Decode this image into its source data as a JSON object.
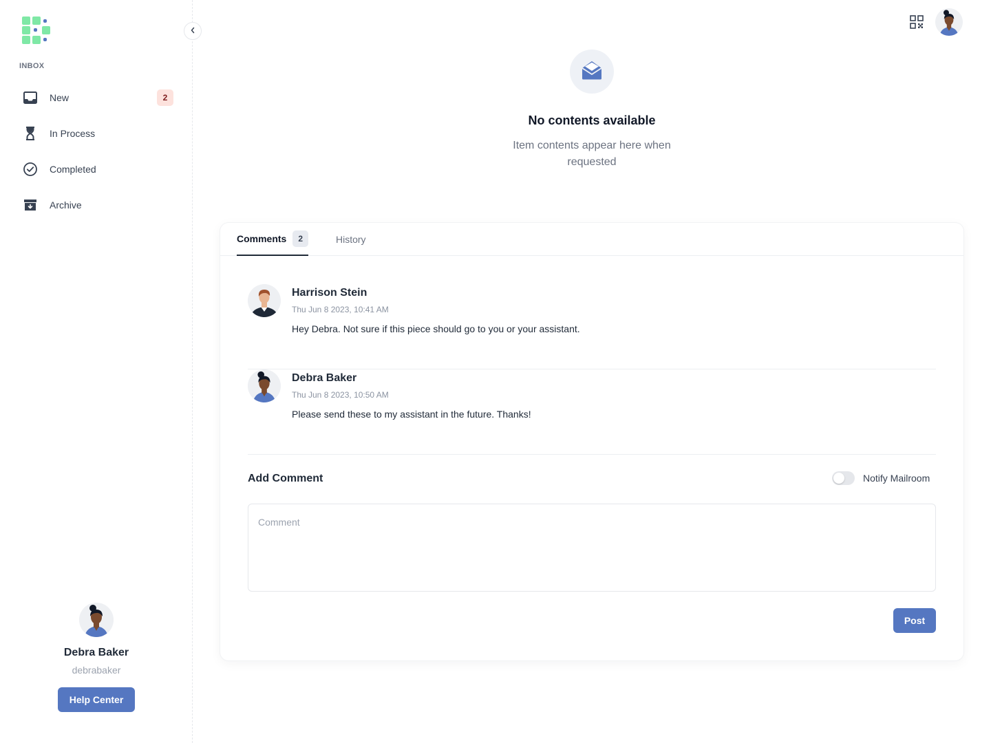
{
  "colors": {
    "accent": "#5577c1",
    "logo_green": "#7fe8a6",
    "logo_blue": "#5577c1",
    "badge_bg": "#fde2dd"
  },
  "sidebar": {
    "section_label": "INBOX",
    "items": [
      {
        "label": "New",
        "icon": "inbox-tray-icon",
        "badge": "2"
      },
      {
        "label": "In Process",
        "icon": "hourglass-icon"
      },
      {
        "label": "Completed",
        "icon": "check-circle-icon"
      },
      {
        "label": "Archive",
        "icon": "archive-box-icon"
      }
    ],
    "collapse_icon": "chevron-left-icon",
    "profile": {
      "name": "Debra Baker",
      "username": "debrabaker",
      "help_label": "Help Center"
    }
  },
  "header": {
    "qr_icon": "qr-code-icon"
  },
  "empty_state": {
    "icon": "envelope-open-icon",
    "title": "No contents available",
    "description": "Item contents appear here when requested"
  },
  "tabs": {
    "comments_label": "Comments",
    "comments_count": "2",
    "history_label": "History"
  },
  "comments": [
    {
      "author": "Harrison Stein",
      "time": "Thu Jun 8 2023, 10:41 AM",
      "text": "Hey Debra. Not sure if this piece should go to you or your assistant."
    },
    {
      "author": "Debra Baker",
      "time": "Thu Jun 8 2023, 10:50 AM",
      "text": "Please send these to my assistant in the future. Thanks!"
    }
  ],
  "add_comment": {
    "title": "Add Comment",
    "notify_label": "Notify Mailroom",
    "notify_on": false,
    "placeholder": "Comment",
    "post_label": "Post"
  }
}
